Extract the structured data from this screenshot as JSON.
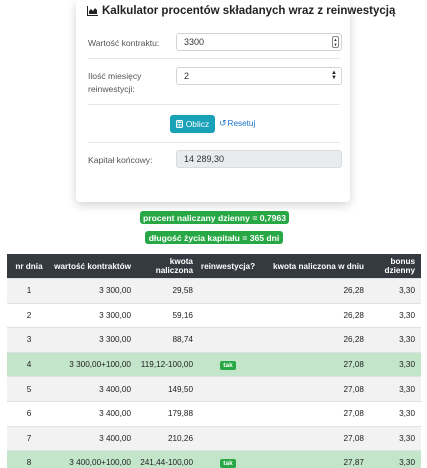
{
  "card": {
    "title": "Kalkulator procentów składanych wraz z reinwestycją",
    "title_icon": "area-chart-icon",
    "contract_label": "Wartość kontraktu:",
    "contract_value": "3300",
    "months_label_line1": "Ilość miesięcy",
    "months_label_line2": "reinwestycji:",
    "months_value": "2",
    "calc_button": "Oblicz",
    "reset_link": "Resetuj",
    "final_label": "Kapitał końcowy:",
    "final_value": "14 289,30"
  },
  "badges": {
    "daily_rate": "procent naliczany dzienny = 0,7963",
    "lifetime": "długość życia kapitału = 365 dni"
  },
  "colors": {
    "accent": "#17a2b8",
    "success": "#28a745",
    "table_header": "#343a40",
    "reinvest_row": "#c3e6cb"
  },
  "table": {
    "headers": [
      "nr dnia",
      "wartość kontraktów",
      "kwota naliczona",
      "reinwestycja?",
      "kwota naliczona w dniu",
      "bonus dzienny"
    ],
    "rows": [
      {
        "day": "1",
        "contracts": "3 300,00",
        "accrued": "29,58",
        "reinvest": "",
        "accrued_day": "26,28",
        "bonus": "3,30"
      },
      {
        "day": "2",
        "contracts": "3 300,00",
        "accrued": "59,16",
        "reinvest": "",
        "accrued_day": "26,28",
        "bonus": "3,30"
      },
      {
        "day": "3",
        "contracts": "3 300,00",
        "accrued": "88,74",
        "reinvest": "",
        "accrued_day": "26,28",
        "bonus": "3,30"
      },
      {
        "day": "4",
        "contracts": "3 300,00+100,00",
        "accrued": "119,12-100,00",
        "reinvest": "tak",
        "accrued_day": "27,08",
        "bonus": "3,30"
      },
      {
        "day": "5",
        "contracts": "3 400,00",
        "accrued": "149,50",
        "reinvest": "",
        "accrued_day": "27,08",
        "bonus": "3,30"
      },
      {
        "day": "6",
        "contracts": "3 400,00",
        "accrued": "179,88",
        "reinvest": "",
        "accrued_day": "27,08",
        "bonus": "3,30"
      },
      {
        "day": "7",
        "contracts": "3 400,00",
        "accrued": "210,26",
        "reinvest": "",
        "accrued_day": "27,08",
        "bonus": "3,30"
      },
      {
        "day": "8",
        "contracts": "3 400,00+100,00",
        "accrued": "241,44-100,00",
        "reinvest": "tak",
        "accrued_day": "27,87",
        "bonus": "3,30"
      }
    ]
  }
}
